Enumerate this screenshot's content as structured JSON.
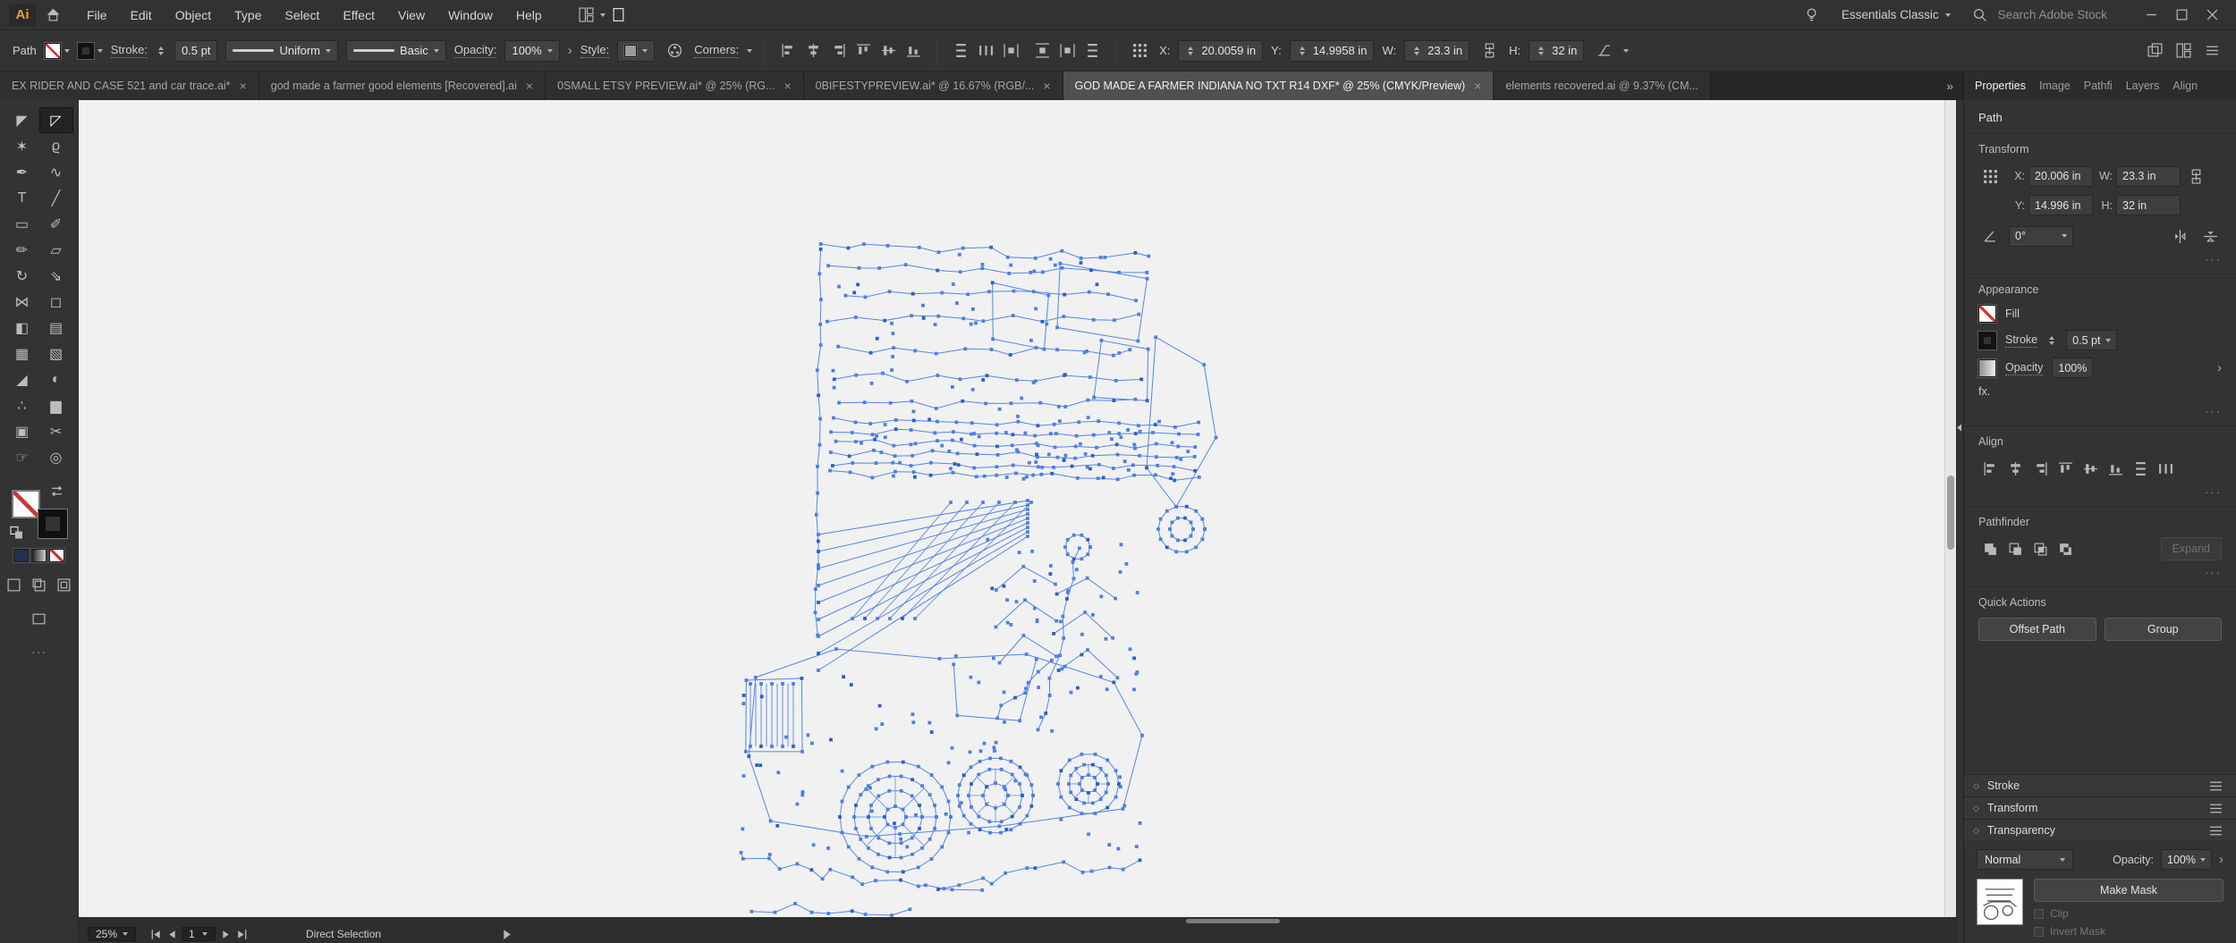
{
  "menu_bar": {
    "logo": "Ai",
    "items": [
      "File",
      "Edit",
      "Object",
      "Type",
      "Select",
      "Effect",
      "View",
      "Window",
      "Help"
    ],
    "workspace_label": "Essentials Classic",
    "search_placeholder": "Search Adobe Stock"
  },
  "control_bar": {
    "selection_type": "Path",
    "stroke_label": "Stroke:",
    "stroke_value": "0.5 pt",
    "width_profile": "Uniform",
    "brush": "Basic",
    "opacity_label": "Opacity:",
    "opacity_value": "100%",
    "style_label": "Style:",
    "corners_label": "Corners:",
    "x_label": "X:",
    "x_value": "20.0059 in",
    "y_label": "Y:",
    "y_value": "14.9958 in",
    "w_label": "W:",
    "w_value": "23.3 in",
    "h_label": "H:",
    "h_value": "32 in",
    "align_icons": [
      "align-left",
      "align-hcenter",
      "align-right",
      "align-top",
      "align-vmiddle",
      "align-bottom"
    ],
    "distribute_icons": [
      "dist-vert",
      "dist-horiz",
      "dist-space-h"
    ],
    "spacing_icons": [
      "dist-space-v",
      "dist-space-h",
      "dist-vert"
    ],
    "right_icons": [
      "stack",
      "grid-arrange",
      "menu"
    ]
  },
  "document_tabs": [
    {
      "label": "EX RIDER AND CASE 521 and car trace.ai*",
      "active": false,
      "closable": true
    },
    {
      "label": "god made a farmer good elements [Recovered].ai",
      "active": false,
      "closable": true
    },
    {
      "label": "0SMALL ETSY PREVIEW.ai* @ 25% (RG...",
      "active": false,
      "closable": true
    },
    {
      "label": "0BIFESTYPREVIEW.ai* @ 16.67% (RGB/...",
      "active": false,
      "closable": true
    },
    {
      "label": "GOD MADE A FARMER INDIANA NO TXT R14 DXF* @ 25% (CMYK/Preview)",
      "active": true,
      "closable": true
    },
    {
      "label": "elements recovered.ai @ 9.37% (CM...",
      "active": false,
      "closable": false
    }
  ],
  "tab_overflow": "»",
  "panel_tabs": [
    {
      "label": "Properties",
      "active": true
    },
    {
      "label": "Image",
      "active": false
    },
    {
      "label": "Pathfi",
      "active": false
    },
    {
      "label": "Layers",
      "active": false
    },
    {
      "label": "Align",
      "active": false
    }
  ],
  "toolbar": {
    "tools": [
      {
        "name": "selection-tool",
        "glyph": "◤",
        "active": false
      },
      {
        "name": "direct-selection-tool",
        "glyph": "◸",
        "active": true
      },
      {
        "name": "magic-wand-tool",
        "glyph": "✶",
        "active": false
      },
      {
        "name": "lasso-tool",
        "glyph": "ϱ",
        "active": false
      },
      {
        "name": "pen-tool",
        "glyph": "✒",
        "active": false
      },
      {
        "name": "curvature-tool",
        "glyph": "∿",
        "active": false
      },
      {
        "name": "type-tool",
        "glyph": "T",
        "active": false
      },
      {
        "name": "line-segment-tool",
        "glyph": "╱",
        "active": false
      },
      {
        "name": "rectangle-tool",
        "glyph": "▭",
        "active": false
      },
      {
        "name": "paintbrush-tool",
        "glyph": "✐",
        "active": false
      },
      {
        "name": "pencil-tool",
        "glyph": "✏",
        "active": false
      },
      {
        "name": "eraser-tool",
        "glyph": "▱",
        "active": false
      },
      {
        "name": "rotate-tool",
        "glyph": "↻",
        "active": false
      },
      {
        "name": "scale-tool",
        "glyph": "⇘",
        "active": false
      },
      {
        "name": "width-tool",
        "glyph": "⋈",
        "active": false
      },
      {
        "name": "free-transform-tool",
        "glyph": "◻",
        "active": false
      },
      {
        "name": "shape-builder-tool",
        "glyph": "◧",
        "active": false
      },
      {
        "name": "perspective-grid-tool",
        "glyph": "▤",
        "active": false
      },
      {
        "name": "mesh-tool",
        "glyph": "▦",
        "active": false
      },
      {
        "name": "gradient-tool",
        "glyph": "▧",
        "active": false
      },
      {
        "name": "eyedropper-tool",
        "glyph": "◢",
        "active": false
      },
      {
        "name": "blend-tool",
        "glyph": "◐",
        "active": false
      },
      {
        "name": "symbol-sprayer-tool",
        "glyph": "∴",
        "active": false
      },
      {
        "name": "column-graph-tool",
        "glyph": "▆",
        "active": false
      },
      {
        "name": "artboard-tool",
        "glyph": "▣",
        "active": false
      },
      {
        "name": "slice-tool",
        "glyph": "✂",
        "active": false
      },
      {
        "name": "hand-tool",
        "glyph": "☞",
        "active": false
      },
      {
        "name": "zoom-tool",
        "glyph": "◎",
        "active": false
      }
    ]
  },
  "properties": {
    "object_type": "Path",
    "more_label": "···",
    "transform": {
      "title": "Transform",
      "x_label": "X:",
      "x": "20.006 in",
      "y_label": "Y:",
      "y": "14.996 in",
      "w_label": "W:",
      "w": "23.3 in",
      "h_label": "H:",
      "h": "32 in",
      "angle": "0°"
    },
    "appearance": {
      "title": "Appearance",
      "fill_label": "Fill",
      "stroke_label": "Stroke",
      "stroke_weight": "0.5 pt",
      "opacity_label": "Opacity",
      "opacity_value": "100%",
      "fx_label": "fx."
    },
    "align": {
      "title": "Align",
      "icons": [
        "align-left",
        "align-hcenter",
        "align-right",
        "align-top",
        "align-vmiddle",
        "align-bottom",
        "dist-vert",
        "dist-horiz"
      ]
    },
    "pathfinder": {
      "title": "Pathfinder",
      "icons": [
        "unite",
        "minus-front",
        "intersect",
        "exclude"
      ],
      "expand_label": "Expand"
    },
    "quick_actions": {
      "title": "Quick Actions",
      "offset_path_label": "Offset Path",
      "group_label": "Group"
    },
    "stacked_panels": {
      "stroke_title": "Stroke",
      "transform_title": "Transform",
      "transparency_title": "Transparency"
    },
    "transparency": {
      "blend_mode": "Normal",
      "opacity_label": "Opacity:",
      "opacity_value": "100%",
      "make_mask_label": "Make Mask",
      "clip_label": "Clip",
      "invert_mask_label": "Invert Mask"
    }
  },
  "status_bar": {
    "zoom": "25%",
    "artboard_number": "1",
    "tool_name": "Direct Selection"
  },
  "artwork": {
    "selection_color": "#4b80e2",
    "description": "Selected vector line art (farmer / tractor scene) showing anchor points at 25% zoom"
  }
}
